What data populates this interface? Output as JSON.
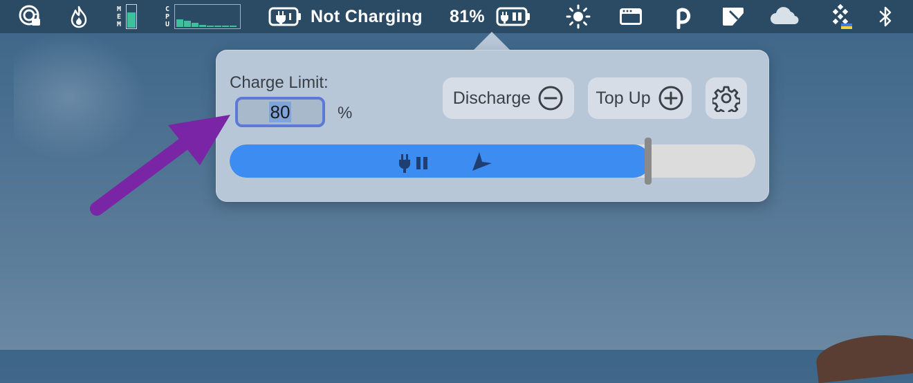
{
  "menubar": {
    "mem_label": "MEM",
    "mem_level": 0.7,
    "cpu_label": "CPU",
    "cpu_samples": [
      0.35,
      0.3,
      0.2,
      0.1,
      0.05,
      0.08,
      0.05,
      0.06
    ],
    "charging_status": "Not Charging",
    "battery_percent": "81%",
    "icons": [
      "privacy-lock-icon",
      "flame-icon",
      "mem-meter-icon",
      "cpu-graph-icon",
      "battery-plug-icon",
      "battery-status-icon",
      "brightness-icon",
      "window-bar-icon",
      "p-logo-icon",
      "screenshot-tool-icon",
      "cloud-icon",
      "grid-app-icon",
      "bluetooth-icon"
    ]
  },
  "popover": {
    "charge_limit_label": "Charge Limit:",
    "charge_limit_value": "80",
    "percent_sign": "%",
    "discharge_label": "Discharge",
    "topup_label": "Top Up",
    "slider_level": 0.8
  },
  "colors": {
    "accent": "#3d8cf2",
    "annotation_arrow": "#7a24a6",
    "menubar": "#2b4a64",
    "popover_bg": "#b8c7d8"
  }
}
